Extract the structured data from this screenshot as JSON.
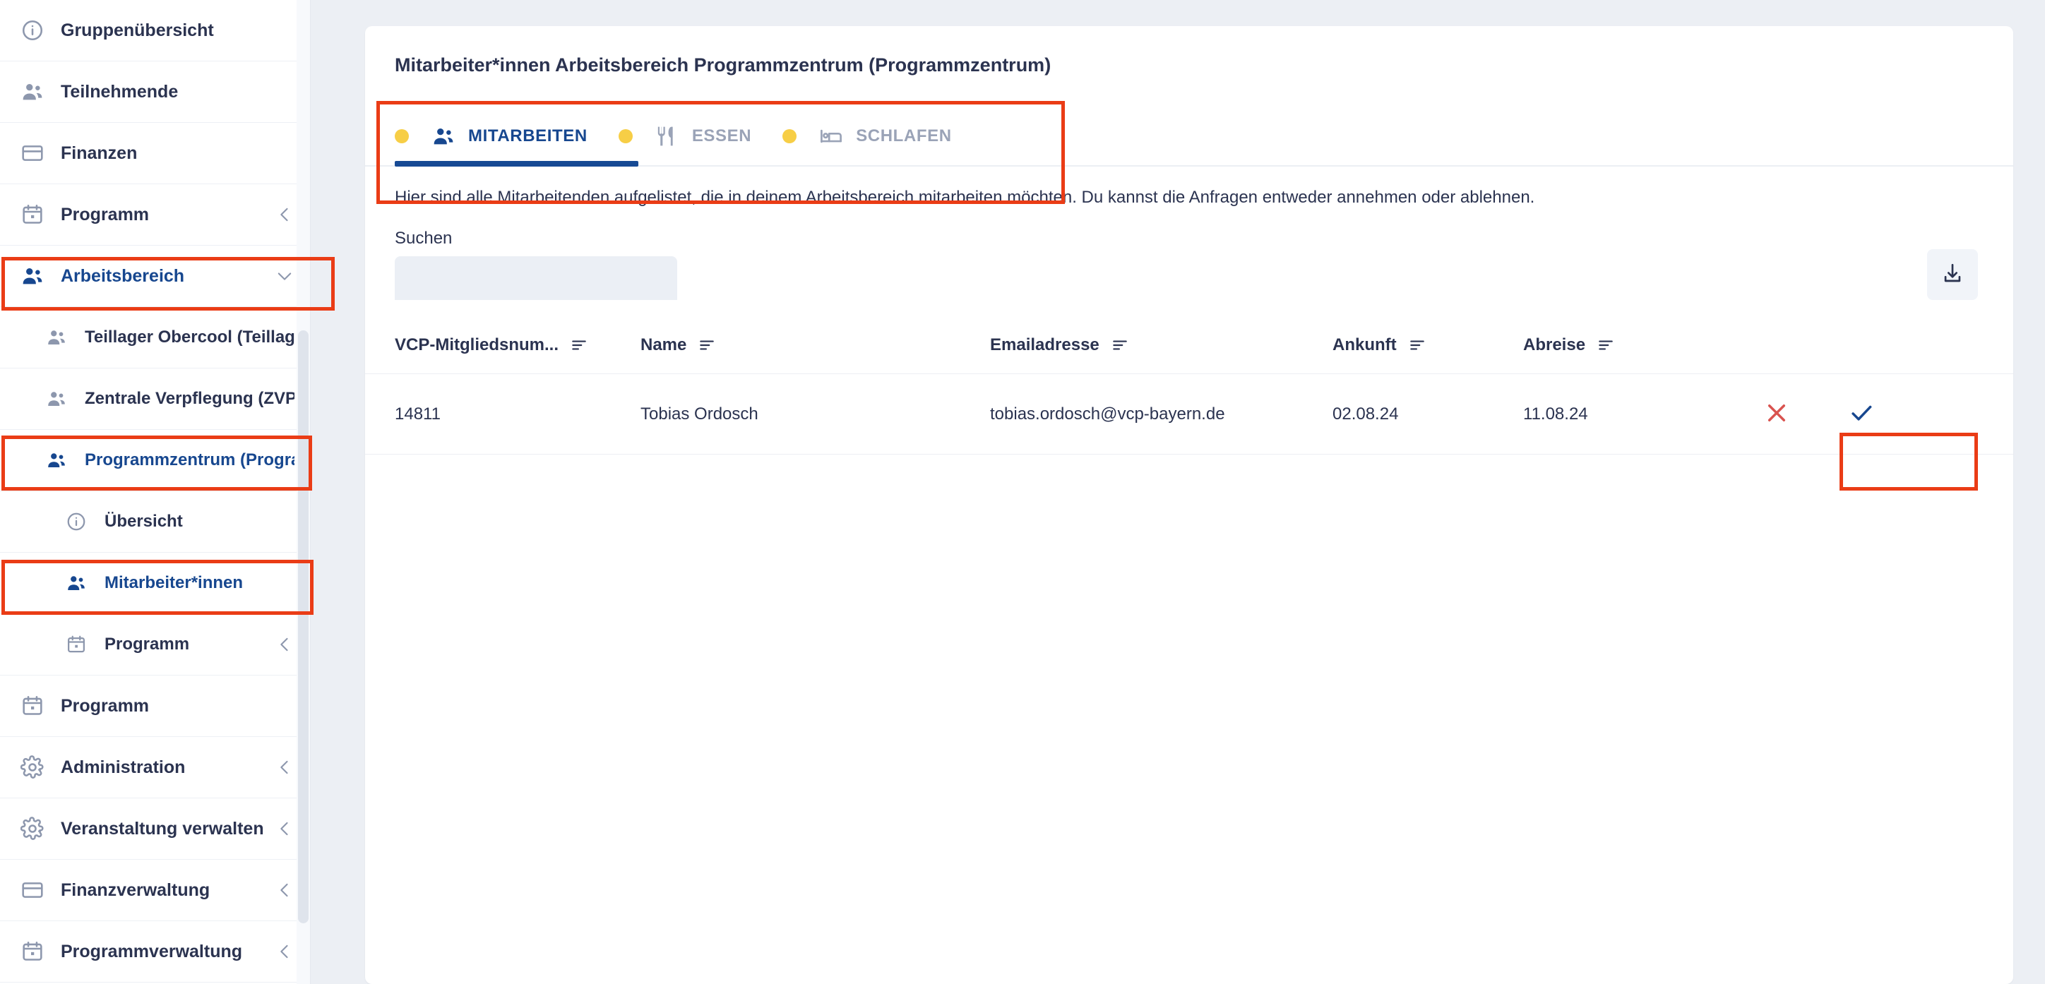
{
  "sidebar": {
    "items": [
      {
        "label": "Gruppenübersicht",
        "icon": "info-icon",
        "level": 0,
        "active": false,
        "chevron": ""
      },
      {
        "label": "Teilnehmende",
        "icon": "people-icon",
        "level": 0,
        "active": false,
        "chevron": ""
      },
      {
        "label": "Finanzen",
        "icon": "card-icon",
        "level": 0,
        "active": false,
        "chevron": ""
      },
      {
        "label": "Programm",
        "icon": "calendar-icon",
        "level": 0,
        "active": false,
        "chevron": "chevron-left"
      },
      {
        "label": "Arbeitsbereich",
        "icon": "people-icon",
        "level": 0,
        "active": true,
        "chevron": "chevron-down"
      },
      {
        "label": "Teillager Obercool (Teillager)",
        "icon": "people-icon",
        "level": 1,
        "active": false,
        "chevron": ""
      },
      {
        "label": "Zentrale Verpflegung (ZVP)",
        "icon": "people-icon",
        "level": 1,
        "active": false,
        "chevron": ""
      },
      {
        "label": "Programmzentrum (Programmzentrum)",
        "icon": "people-icon",
        "level": 1,
        "active": true,
        "chevron": ""
      },
      {
        "label": "Übersicht",
        "icon": "info-icon",
        "level": 2,
        "active": false,
        "chevron": ""
      },
      {
        "label": "Mitarbeiter*innen",
        "icon": "people-icon",
        "level": 2,
        "active": true,
        "chevron": ""
      },
      {
        "label": "Programm",
        "icon": "calendar-icon",
        "level": 2,
        "active": false,
        "chevron": "chevron-left"
      },
      {
        "label": "Programm",
        "icon": "calendar-icon",
        "level": 0,
        "active": false,
        "chevron": ""
      },
      {
        "label": "Administration",
        "icon": "gear-icon",
        "level": 0,
        "active": false,
        "chevron": "chevron-left"
      },
      {
        "label": "Veranstaltung verwalten",
        "icon": "gear-icon",
        "level": 0,
        "active": false,
        "chevron": "chevron-left"
      },
      {
        "label": "Finanzverwaltung",
        "icon": "card-icon",
        "level": 0,
        "active": false,
        "chevron": "chevron-left"
      },
      {
        "label": "Programmverwaltung",
        "icon": "calendar-icon",
        "level": 0,
        "active": false,
        "chevron": "chevron-left"
      }
    ]
  },
  "card": {
    "title": "Mitarbeiter*innen Arbeitsbereich Programmzentrum (Programmzentrum)",
    "description": "Hier sind alle Mitarbeitenden aufgelistet, die in deinem Arbeitsbereich mitarbeiten möchten. Du kannst die Anfragen entweder annehmen oder ablehnen.",
    "tabs": [
      {
        "label": "MITARBEITEN",
        "icon": "people-icon",
        "selected": true,
        "dot": "#f7ce46"
      },
      {
        "label": "ESSEN",
        "icon": "cutlery-icon",
        "selected": false,
        "dot": "#f7ce46"
      },
      {
        "label": "SCHLAFEN",
        "icon": "bed-icon",
        "selected": false,
        "dot": "#f7ce46"
      }
    ],
    "search": {
      "label": "Suchen",
      "value": "",
      "placeholder": ""
    },
    "download_button": {
      "icon": "download-icon",
      "label": ""
    },
    "table": {
      "columns": [
        {
          "label": "VCP-Mitgliedsnum...",
          "sortable": true
        },
        {
          "label": "Name",
          "sortable": true
        },
        {
          "label": "Emailadresse",
          "sortable": true
        },
        {
          "label": "Ankunft",
          "sortable": true
        },
        {
          "label": "Abreise",
          "sortable": true
        },
        {
          "label": "",
          "sortable": false
        }
      ],
      "rows": [
        {
          "membership_number": "14811",
          "name": "Tobias Ordosch",
          "email": "tobias.ordosch@vcp-bayern.de",
          "arrival": "02.08.24",
          "departure": "11.08.24",
          "reject_label": "Ablehnen",
          "accept_label": "Annehmen"
        }
      ]
    }
  },
  "colors": {
    "brand_blue": "#17478f",
    "highlight_red": "#ea3c16",
    "dot_yellow": "#f7ce46",
    "reject_red": "#d9534f",
    "text_dark": "#2b3350",
    "muted": "#9aa3b7",
    "page_bg": "#eceff4"
  }
}
